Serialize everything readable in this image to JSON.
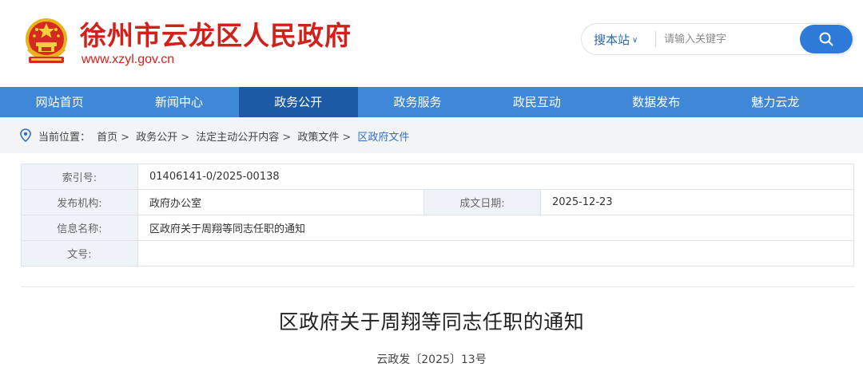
{
  "header": {
    "site_title": "徐州市云龙区人民政府",
    "site_url": "www.xzyl.gov.cn"
  },
  "search": {
    "scope_label": "搜本站",
    "placeholder": "请输入关键字"
  },
  "nav": {
    "items": [
      "网站首页",
      "新闻中心",
      "政务公开",
      "政务服务",
      "政民互动",
      "数据发布",
      "魅力云龙"
    ],
    "active_index": 2
  },
  "breadcrumb": {
    "label": "当前位置：",
    "items": [
      "首页",
      "政务公开",
      "法定主动公开内容",
      "政策文件",
      "区政府文件"
    ],
    "separator": ">"
  },
  "info": {
    "index_label": "索引号:",
    "index_value": "01406141-0/2025-00138",
    "publisher_label": "发布机构:",
    "publisher_value": "政府办公室",
    "date_label": "成文日期:",
    "date_value": "2025-12-23",
    "name_label": "信息名称:",
    "name_value": "区政府关于周翔等同志任职的通知",
    "docno_label": "文号:",
    "docno_value": ""
  },
  "document": {
    "title": "区政府关于周翔等同志任职的通知",
    "number": "云政发〔2025〕13号"
  },
  "colors": {
    "brand_red": "#d2201a",
    "nav_blue": "#3f88d8",
    "nav_active": "#1d5aa6",
    "accent_blue": "#2e7ad8"
  }
}
